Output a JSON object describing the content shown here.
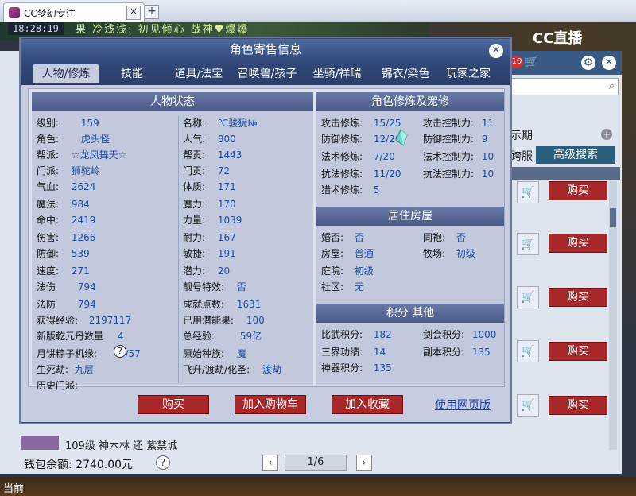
{
  "browser": {
    "tab_title": "CC梦幻专注",
    "close_glyph": "✕",
    "newtab_glyph": "+"
  },
  "game": {
    "clock": "18:28:19",
    "ticker": "果  冷浅浅:  初见倾心   战神♥爆爆",
    "logo": "CC直播"
  },
  "market_bg": {
    "cart_count": "10",
    "period_label": "示期",
    "server_label": "跨服",
    "advanced_search": "高级搜索",
    "buy_label": "购买",
    "row_text": "109级  神木林  还    紫禁城",
    "wallet": "钱包余额:  2740.00元",
    "page": "1/6",
    "taskbar_label": "当前"
  },
  "dialog": {
    "title": "角色寄售信息",
    "tabs": [
      "人物/修炼",
      "技能",
      "道具/法宝",
      "召唤兽/孩子",
      "坐骑/祥瑞",
      "锦衣/染色",
      "玩家之家"
    ],
    "status_title": "人物状态",
    "status_left": [
      {
        "k": "级别:",
        "v": "159"
      },
      {
        "k": "角色:",
        "v": "虎头怪"
      },
      {
        "k": "帮派:",
        "v": "☆龙凤舞天☆"
      },
      {
        "k": "门派:",
        "v": "狮驼岭"
      },
      {
        "k": "气血:",
        "v": "2624"
      },
      {
        "k": "魔法:",
        "v": "984"
      },
      {
        "k": "命中:",
        "v": "2419"
      },
      {
        "k": "伤害:",
        "v": "1266"
      },
      {
        "k": "防御:",
        "v": "539"
      },
      {
        "k": "速度:",
        "v": "271"
      },
      {
        "k": "法伤",
        "v": "794"
      },
      {
        "k": "法防",
        "v": "794"
      },
      {
        "k": "获得经验:",
        "v": "2197117"
      },
      {
        "k": "新版乾元丹数量",
        "v": "4"
      },
      {
        "k": "月饼粽子机缘:",
        "v": "3/57"
      },
      {
        "k": "生死劫:",
        "v": "九层"
      },
      {
        "k": "历史门派:",
        "v": ""
      }
    ],
    "status_right": [
      {
        "k": "名称:",
        "v": "℃骏猊№"
      },
      {
        "k": "人气:",
        "v": "800"
      },
      {
        "k": "帮贡:",
        "v": "1443"
      },
      {
        "k": "门贡:",
        "v": "72"
      },
      {
        "k": "体质:",
        "v": "171"
      },
      {
        "k": "魔力:",
        "v": "170"
      },
      {
        "k": "力量:",
        "v": "1039"
      },
      {
        "k": "耐力:",
        "v": "167"
      },
      {
        "k": "敏捷:",
        "v": "191"
      },
      {
        "k": "潜力:",
        "v": "20"
      },
      {
        "k": "靓号特效:",
        "v": "否"
      },
      {
        "k": "成就点数:",
        "v": "1631"
      },
      {
        "k": "已用潜能果:",
        "v": "100"
      },
      {
        "k": "总经验:",
        "v": "59亿"
      },
      {
        "k": "原始种族:",
        "v": "魔"
      },
      {
        "k": "飞升/渡劫/化圣:",
        "v": "渡劫"
      }
    ],
    "cultivation_title": "角色修炼及宠修",
    "cultivation": [
      {
        "k": "攻击修炼:",
        "v": "15/25",
        "k2": "攻击控制力:",
        "v2": "11"
      },
      {
        "k": "防御修炼:",
        "v": "12/20",
        "k2": "防御控制力:",
        "v2": "9"
      },
      {
        "k": "法术修炼:",
        "v": "7/20",
        "k2": "法术控制力:",
        "v2": "10"
      },
      {
        "k": "抗法修炼:",
        "v": "11/20",
        "k2": "抗法控制力:",
        "v2": "10"
      },
      {
        "k": "猎术修炼:",
        "v": "5",
        "k2": "",
        "v2": ""
      }
    ],
    "house_title": "居住房屋",
    "house": [
      {
        "k": "婚否:",
        "v": "否",
        "k2": "同袍:",
        "v2": "否"
      },
      {
        "k": "房屋:",
        "v": "普通",
        "k2": "牧场:",
        "v2": "初级"
      },
      {
        "k": "庭院:",
        "v": "初级",
        "k2": "",
        "v2": ""
      },
      {
        "k": "社区:",
        "v": "无",
        "k2": "",
        "v2": ""
      }
    ],
    "points_title": "积分 其他",
    "points": [
      {
        "k": "比武积分:",
        "v": "182",
        "k2": "剑会积分:",
        "v2": "1000"
      },
      {
        "k": "三界功绩:",
        "v": "14",
        "k2": "副本积分:",
        "v2": "135"
      },
      {
        "k": "神器积分:",
        "v": "135",
        "k2": "",
        "v2": ""
      }
    ],
    "buttons": {
      "buy": "购买",
      "add_cart": "加入购物车",
      "add_fav": "加入收藏",
      "web_version": "使用网页版"
    },
    "help_glyph": "?"
  },
  "colors": {
    "title_blue": "#324a7a",
    "value_blue": "#1a4aa8",
    "buy_red": "#a8282a"
  },
  "icons": [
    "favicon-icon",
    "close-icon",
    "gear-icon",
    "cart-icon",
    "search-icon",
    "plus-icon",
    "help-icon",
    "crystal-icon",
    "chevron-left-icon",
    "chevron-right-icon"
  ]
}
